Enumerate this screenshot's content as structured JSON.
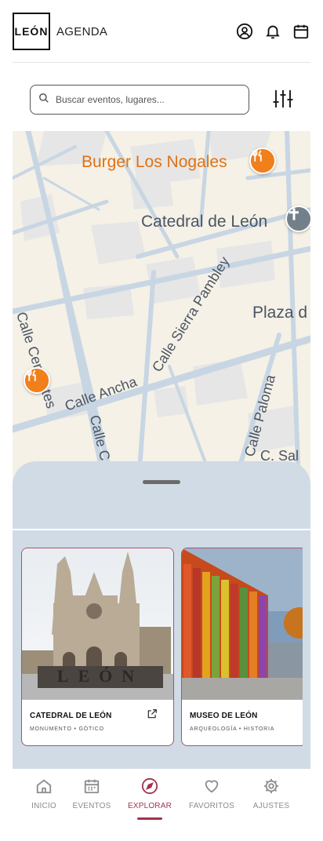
{
  "header": {
    "logo": "LEÓN",
    "title": "AGENDA",
    "icons": [
      "user-circle-icon",
      "bell-icon",
      "calendar-icon"
    ]
  },
  "search": {
    "placeholder": "Buscar eventos, lugares...",
    "icon": "search-icon",
    "filter_icon": "sliders-icon"
  },
  "map": {
    "labels": {
      "burger": "Burger Los Nogales",
      "catedral": "Catedral de León",
      "plaza": "Plaza d",
      "cervantes": "Calle Cervantes",
      "sierra": "Calle Sierra Pambley",
      "ancha": "Calle Ancha",
      "calle_c": "Calle C",
      "paloma": "Calle Paloma",
      "c_sal": "C. Sal"
    },
    "pins": [
      "restaurant-pin-icon",
      "restaurant-pin-icon",
      "church-pin-icon"
    ]
  },
  "cards": [
    {
      "title": "CATEDRAL DE LEÓN",
      "subtitle": "MONUMENTO • GÓTICO",
      "sign": "LEÓN"
    },
    {
      "title": "MUSEO DE LEÓN",
      "subtitle": "ARQUEOLOGÍA • HISTORIA"
    }
  ],
  "nav": {
    "items": [
      {
        "label": "INICIO",
        "icon": "home-icon"
      },
      {
        "label": "EVENTOS",
        "icon": "calendar-grid-icon"
      },
      {
        "label": "EXPLORAR",
        "icon": "compass-icon"
      },
      {
        "label": "FAVORITOS",
        "icon": "heart-icon"
      },
      {
        "label": "AJUSTES",
        "icon": "gear-icon"
      }
    ],
    "active": "EXPLORAR"
  },
  "colors": {
    "accent": "#a3324d",
    "pin_orange": "#f07f1c",
    "sheet": "#d0dbe6",
    "map_base": "#f5f1e6",
    "road": "#c8d6e4"
  }
}
